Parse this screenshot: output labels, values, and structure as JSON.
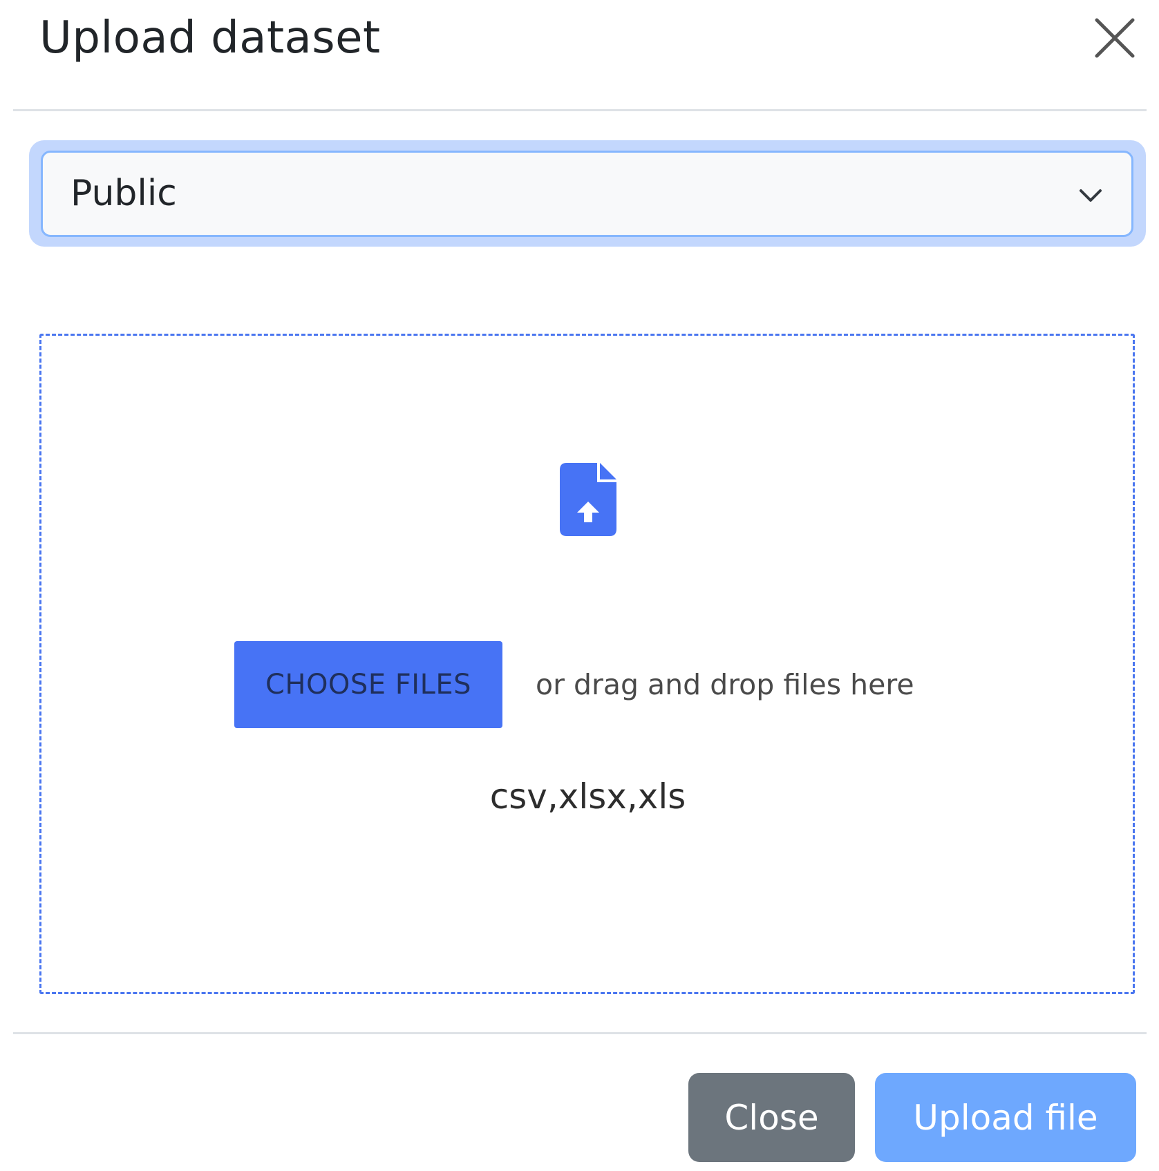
{
  "modal": {
    "title": "Upload dataset"
  },
  "visibility_select": {
    "selected": "Public"
  },
  "dropzone": {
    "choose_label": "CHOOSE FILES",
    "drop_hint": "or drag and drop files here",
    "accepted_formats": "csv,xlsx,xls"
  },
  "footer": {
    "close_label": "Close",
    "upload_label": "Upload file"
  },
  "icons": {
    "close": "close-icon",
    "chevron": "chevron-down-icon",
    "upload": "file-upload-icon"
  },
  "colors": {
    "primary": "#4773f5",
    "upload_button": "#6ea8fe",
    "secondary": "#6c757d",
    "focus_ring": "#c3d7fd",
    "dropzone_border": "#4a76f0"
  }
}
